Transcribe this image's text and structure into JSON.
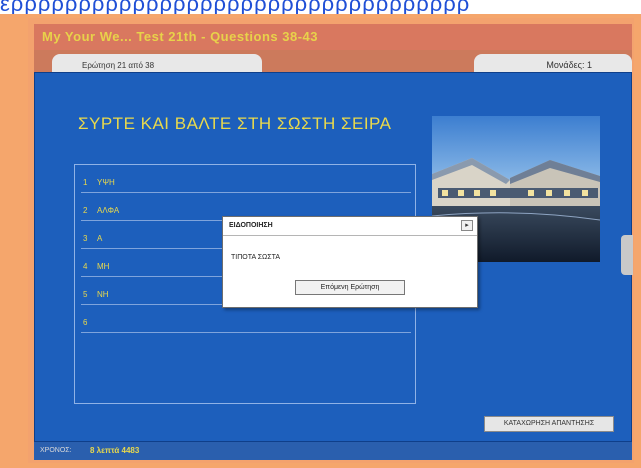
{
  "top_strip": {
    "text": "ερρρρρρρρρρρρρρρρρρρρρρρρρρρρρρρρρρ"
  },
  "window": {
    "title": "My Your We... Test 21th - Questions 38-43"
  },
  "info_bar": {
    "question_counter": "Ερώτηση 21 από 38",
    "score_label": "Μονάδες: 1"
  },
  "question": {
    "instruction": "ΣΥΡΤΕ ΚΑΙ ΒΑΛΤΕ ΣΤΗ ΣΩΣΤΗ ΣΕΙΡΑ",
    "items": [
      {
        "number": "1",
        "text": "ΥΨΗ"
      },
      {
        "number": "2",
        "text": "ΑΛΦΑ"
      },
      {
        "number": "3",
        "text": "Α"
      },
      {
        "number": "4",
        "text": "ΜΗ"
      },
      {
        "number": "5",
        "text": "ΝΗ"
      },
      {
        "number": "6",
        "text": ""
      }
    ]
  },
  "dialog": {
    "title": "ΕΙΔΟΠΟΙΗΣΗ",
    "close_glyph": "▸",
    "message": "ΤΙΠΟΤΑ ΣΩΣΤΑ",
    "button_label": "Επόμενη Ερώτηση"
  },
  "buttons": {
    "submit_label": "ΚΑΤΑΧΩΡΗΣΗ ΑΠΑΝΤΗΣΗΣ"
  },
  "status_bar": {
    "prefix": "ΧΡΟΝΟΣ:",
    "time": "8 λεπτά 4483"
  },
  "colors": {
    "background": "#f5a66c",
    "panel": "#1d5fbc",
    "accent_text": "#e9d94c",
    "title_bar": "#d9785f"
  }
}
